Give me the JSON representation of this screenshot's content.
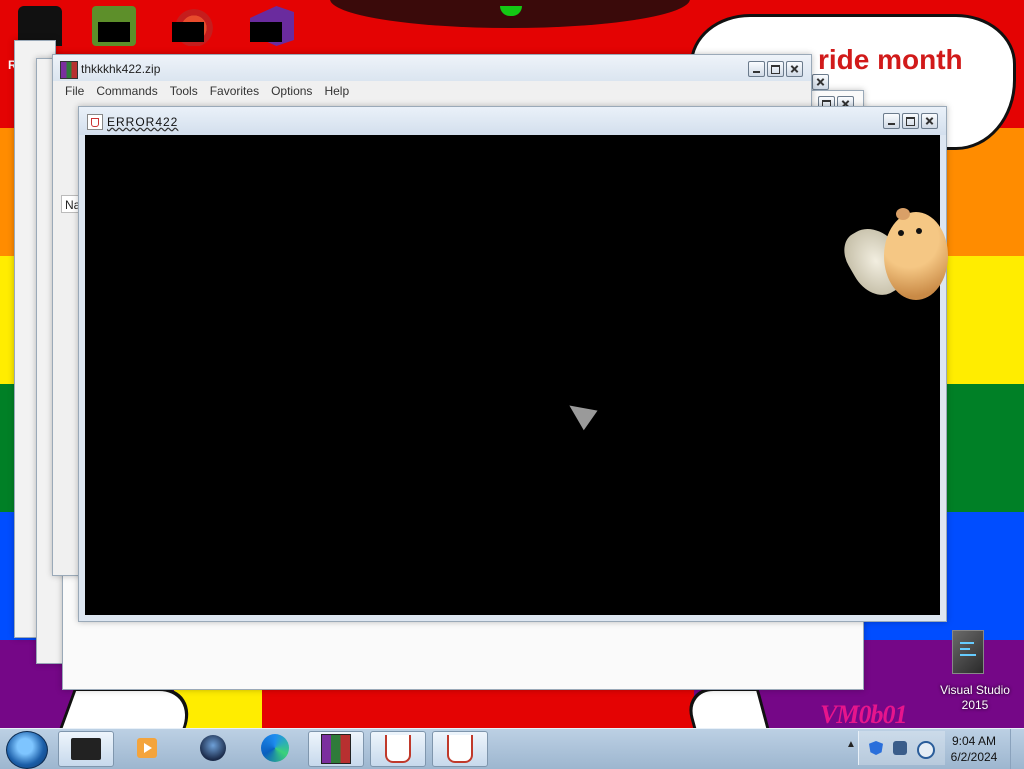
{
  "wallpaper": {
    "bubble_text": "ride month",
    "watermark": "VM0b01",
    "partial_left_char": "R"
  },
  "desktop": {
    "top_icons": [
      "top-hat-icon",
      "meme-icon",
      "browser-icon",
      "visual-studio-icon"
    ],
    "vs_icon": {
      "label": "Visual Studio 2015"
    }
  },
  "winrar_window": {
    "title": "thkkkhk422.zip",
    "menu": [
      "File",
      "Commands",
      "Tools",
      "Favorites",
      "Options",
      "Help"
    ],
    "list_header": "Na"
  },
  "error_window": {
    "title": "ERROR422"
  },
  "taskbar": {
    "items": [
      "monitor-app",
      "media-player",
      "orb-app",
      "edge",
      "winrar",
      "java-1",
      "java-2"
    ],
    "clock": {
      "time": "9:04 AM",
      "date": "6/2/2024"
    }
  },
  "colors": {
    "flag": [
      "#e40303",
      "#ff8c00",
      "#ffed00",
      "#008026",
      "#004dff",
      "#750787"
    ],
    "bubble_text": "#d11a1a",
    "watermark": "#e6158c"
  }
}
